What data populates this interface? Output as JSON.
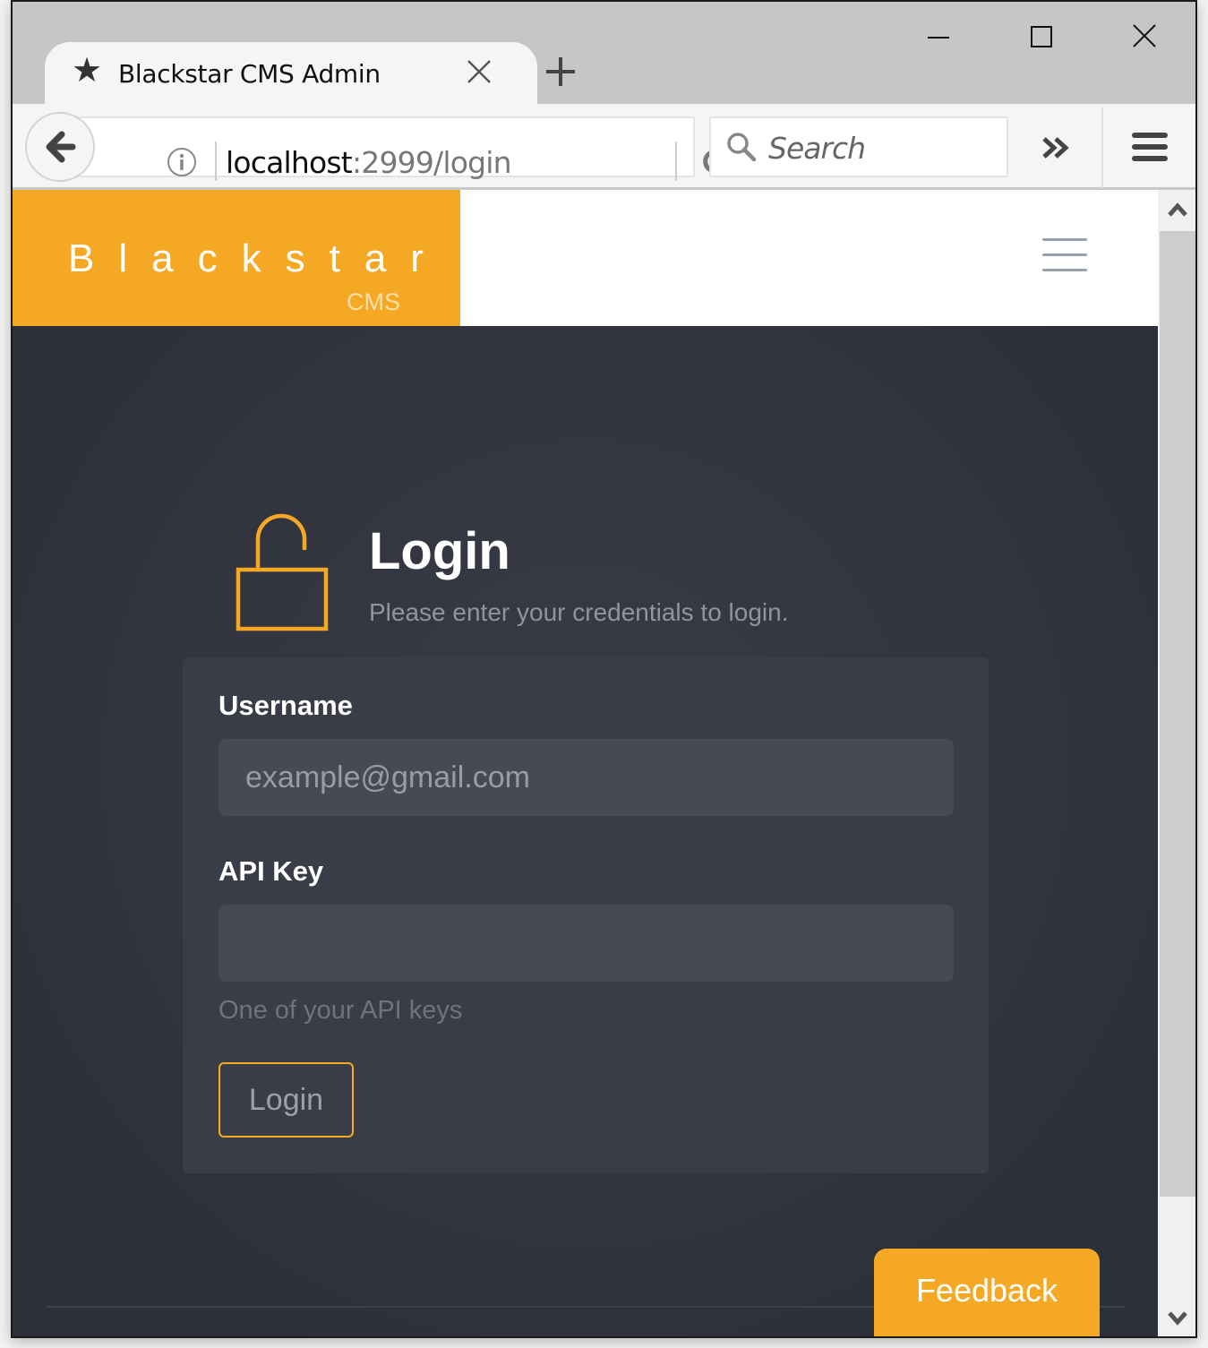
{
  "browser": {
    "tab": {
      "title": "Blackstar CMS Admin",
      "favicon": "star-icon"
    },
    "new_tab_icon": "plus-icon",
    "window_controls": [
      "minimize-icon",
      "maximize-icon",
      "close-icon"
    ],
    "url": {
      "host": "localhost",
      "rest": ":2999/login"
    },
    "search_placeholder": "Search"
  },
  "site": {
    "brand": {
      "name": "Blackstar",
      "subtitle": "CMS",
      "color": "#f5a823"
    },
    "menu_icon": "hamburger-icon"
  },
  "login": {
    "title": "Login",
    "subtitle": "Please enter your credentials to login.",
    "icon": "unlock-icon",
    "fields": {
      "username": {
        "label": "Username",
        "placeholder": "example@gmail.com",
        "value": ""
      },
      "api_key": {
        "label": "API Key",
        "placeholder": "",
        "value": "",
        "help": "One of your API keys"
      }
    },
    "submit_label": "Login"
  },
  "feedback": {
    "label": "Feedback"
  },
  "colors": {
    "accent": "#f5a823",
    "background": "#2e3039",
    "card": "#3a3d47",
    "input": "#474a55"
  }
}
